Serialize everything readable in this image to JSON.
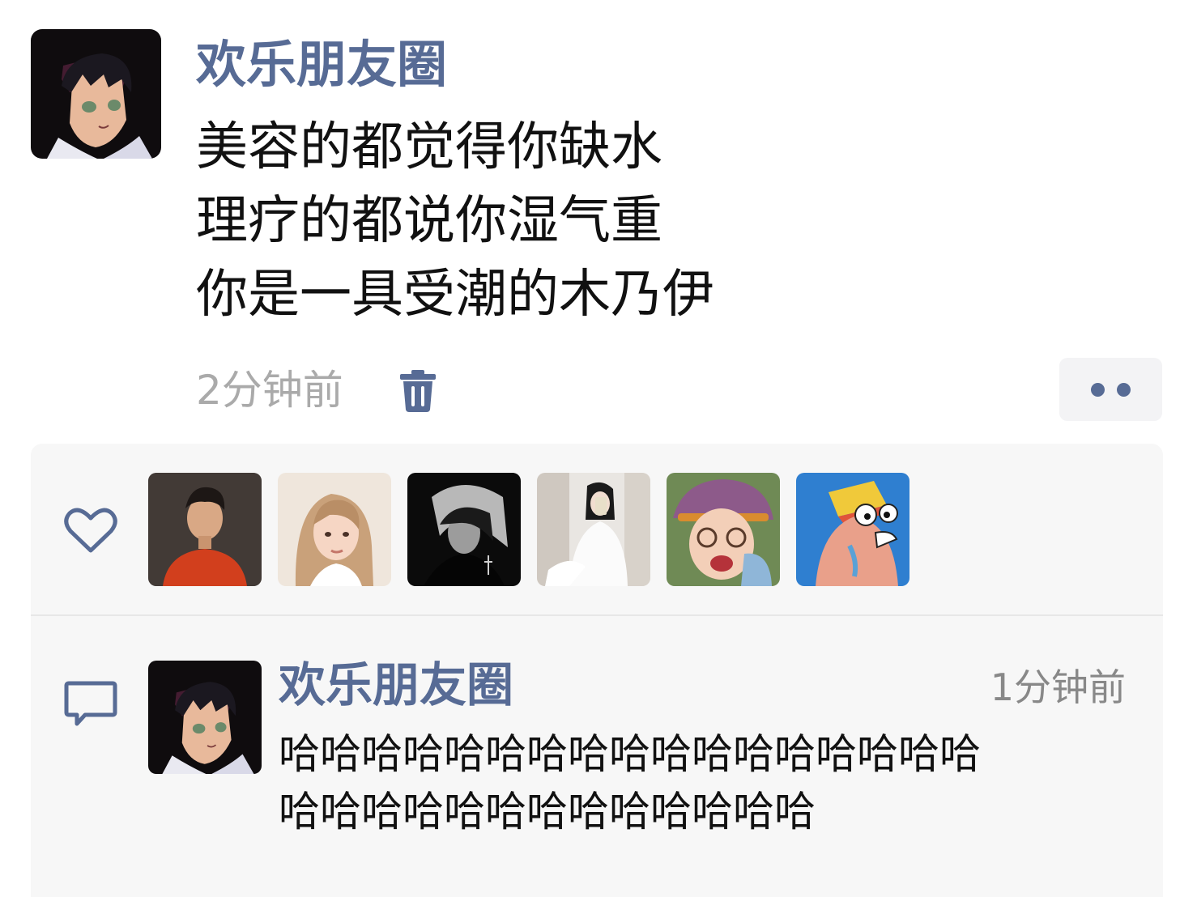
{
  "post": {
    "author": "欢乐朋友圈",
    "avatar_icon": "anime-boy-avatar",
    "lines": [
      "美容的都觉得你缺水",
      "理疗的都说你湿气重",
      "你是一具受潮的木乃伊"
    ],
    "time": "2分钟前",
    "delete_icon": "trash-icon",
    "more_icon": "more-dots-icon"
  },
  "likes": {
    "icon": "heart-icon",
    "avatars": [
      {
        "icon": "avatar-red-shirt-man"
      },
      {
        "icon": "avatar-blonde-woman"
      },
      {
        "icon": "avatar-dark-portrait"
      },
      {
        "icon": "avatar-white-dress-woman"
      },
      {
        "icon": "avatar-girl-glasses-hat"
      },
      {
        "icon": "avatar-cartoon-character"
      }
    ]
  },
  "comment": {
    "icon": "comment-bubble-icon",
    "author": "欢乐朋友圈",
    "time": "1分钟前",
    "lines": [
      "哈哈哈哈哈哈哈哈哈哈哈哈哈哈哈哈哈",
      "哈哈哈哈哈哈哈哈哈哈哈哈哈"
    ]
  },
  "colors": {
    "link_blue": "#576b95",
    "panel_bg": "#f7f7f7",
    "time_gray": "#aaaaaa"
  }
}
